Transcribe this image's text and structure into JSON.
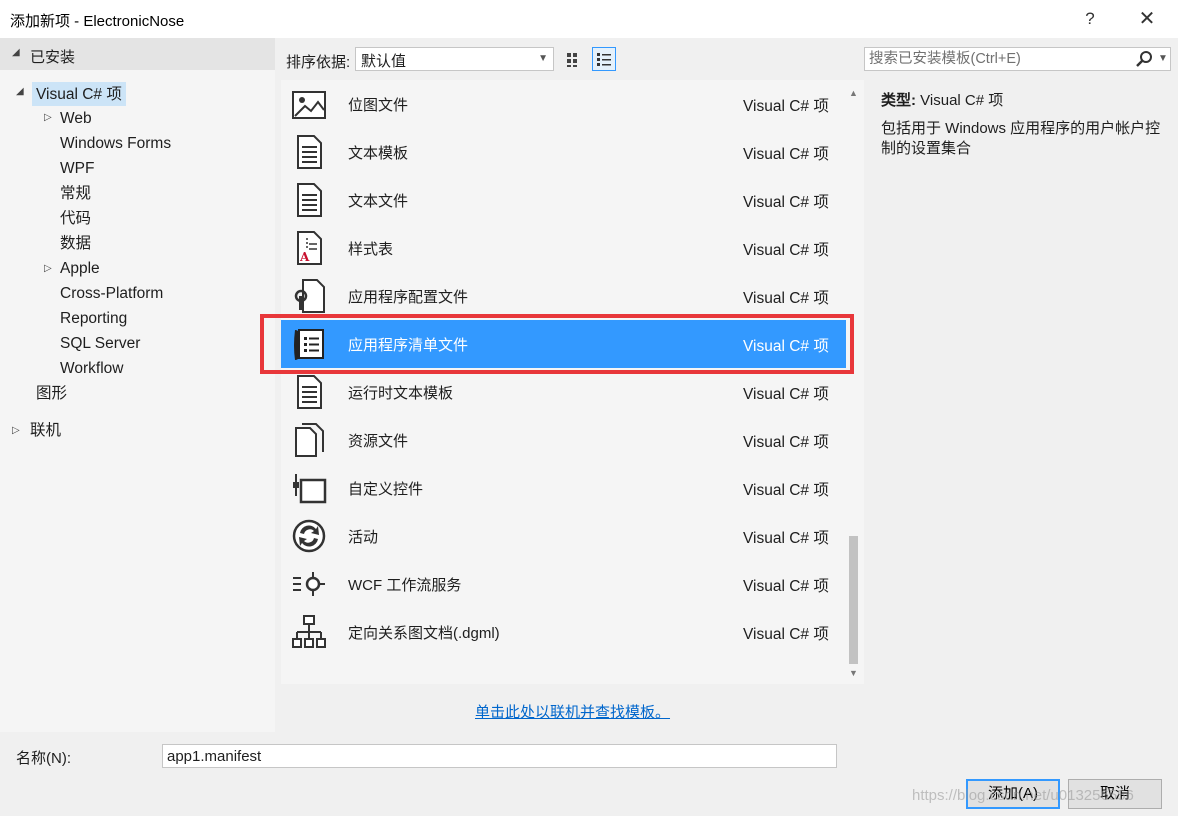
{
  "window": {
    "title": "添加新项 - ElectronicNose",
    "help_label": "?",
    "close_label": "✕"
  },
  "sidebar": {
    "installed_label": "已安装",
    "items": [
      {
        "label": "Visual C# 项"
      },
      {
        "label": "Web"
      },
      {
        "label": "Windows Forms"
      },
      {
        "label": "WPF"
      },
      {
        "label": "常规"
      },
      {
        "label": "代码"
      },
      {
        "label": "数据"
      },
      {
        "label": "Apple"
      },
      {
        "label": "Cross-Platform"
      },
      {
        "label": "Reporting"
      },
      {
        "label": "SQL Server"
      },
      {
        "label": "Workflow"
      },
      {
        "label": "图形"
      },
      {
        "label": "联机"
      }
    ],
    "selected": "Visual C# 项"
  },
  "toolbar": {
    "sort_label": "排序依据:",
    "sort_value": "默认值",
    "search_placeholder": "搜索已安装模板(Ctrl+E)"
  },
  "templates": {
    "items": [
      {
        "name": "位图文件",
        "lang": "Visual C# 项",
        "icon": "bitmap-icon"
      },
      {
        "name": "文本模板",
        "lang": "Visual C# 项",
        "icon": "text-template-icon"
      },
      {
        "name": "文本文件",
        "lang": "Visual C# 项",
        "icon": "text-file-icon"
      },
      {
        "name": "样式表",
        "lang": "Visual C# 项",
        "icon": "stylesheet-icon"
      },
      {
        "name": "应用程序配置文件",
        "lang": "Visual C# 项",
        "icon": "app-config-icon"
      },
      {
        "name": "应用程序清单文件",
        "lang": "Visual C# 项",
        "icon": "app-manifest-icon"
      },
      {
        "name": "运行时文本模板",
        "lang": "Visual C# 项",
        "icon": "runtime-text-template-icon"
      },
      {
        "name": "资源文件",
        "lang": "Visual C# 项",
        "icon": "resource-file-icon"
      },
      {
        "name": "自定义控件",
        "lang": "Visual C# 项",
        "icon": "custom-control-icon"
      },
      {
        "name": "活动",
        "lang": "Visual C# 项",
        "icon": "activity-icon"
      },
      {
        "name": "WCF 工作流服务",
        "lang": "Visual C# 项",
        "icon": "wcf-workflow-icon"
      },
      {
        "name": "定向关系图文档(.dgml)",
        "lang": "Visual C# 项",
        "icon": "dgml-icon"
      }
    ],
    "selected": "应用程序清单文件"
  },
  "details": {
    "type_label": "类型:",
    "type_value": "Visual C# 项",
    "description": "包括用于 Windows 应用程序的用户帐户控制的设置集合"
  },
  "online_link": "单击此处以联机并查找模板。",
  "footer": {
    "name_label": "名称(N):",
    "name_value": "app1.manifest",
    "add_label": "添加(A)",
    "cancel_label": "取消"
  },
  "watermark": "https://blog.csdn.net/u013256556",
  "colors": {
    "selection": "#3399ff",
    "highlight_box": "#e8373a",
    "link": "#0066cc"
  }
}
